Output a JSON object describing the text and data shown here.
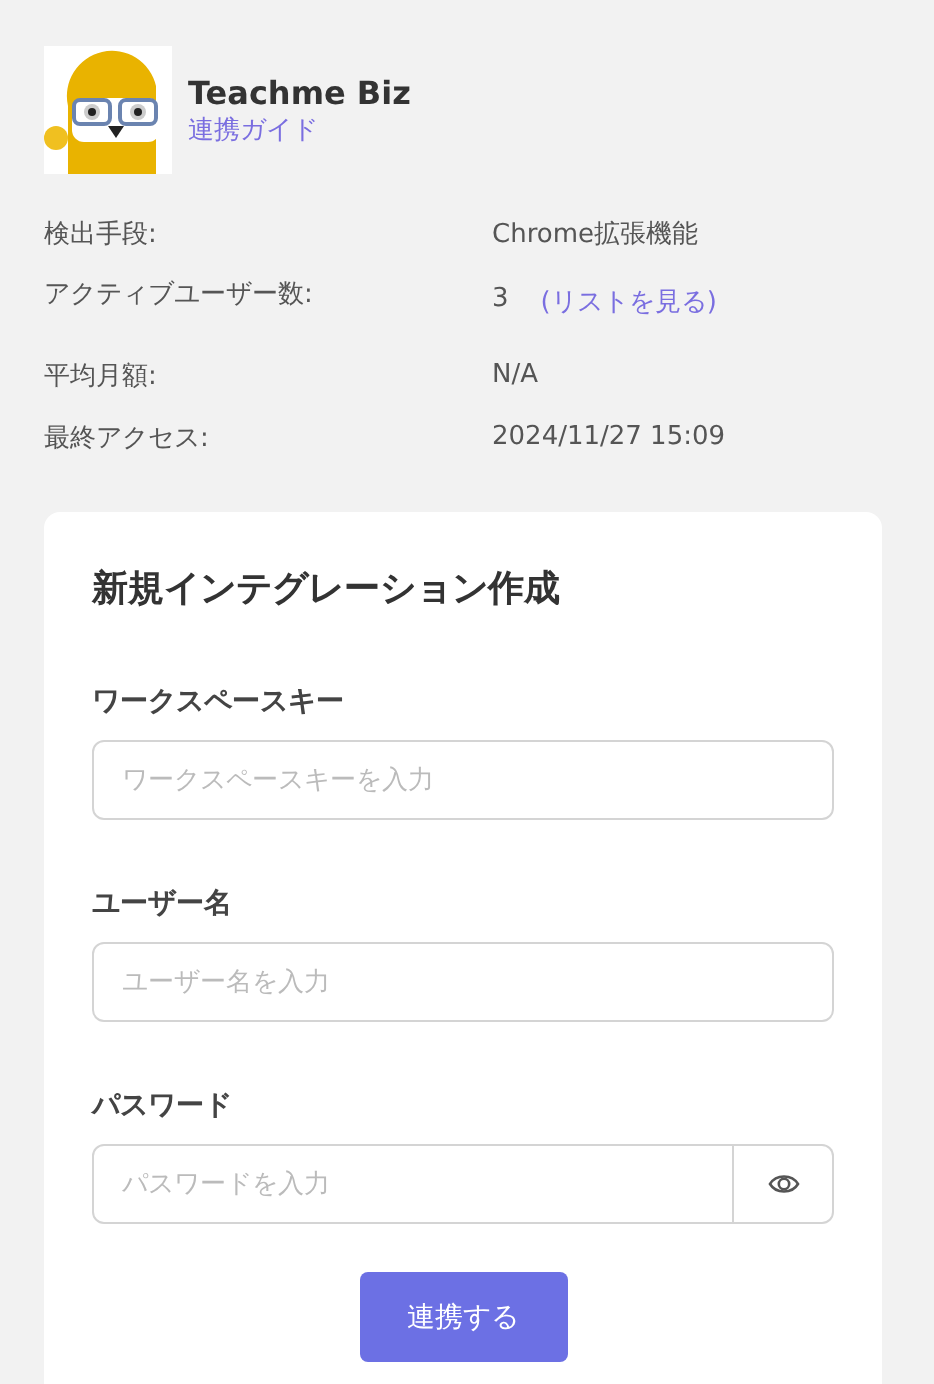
{
  "app": {
    "name": "Teachme Biz",
    "guide_link": "連携ガイド"
  },
  "details": [
    {
      "label": "検出手段:",
      "value": "Chrome拡張機能"
    },
    {
      "label": "アクティブユーザー数:",
      "value": "3",
      "link": "(リストを見る)"
    },
    {
      "label": "平均月額:",
      "value": "N/A"
    },
    {
      "label": "最終アクセス:",
      "value": "2024/11/27 15:09"
    }
  ],
  "form": {
    "title": "新規インテグレーション作成",
    "fields": [
      {
        "kind": "text",
        "label": "ワークスペースキー",
        "placeholder": "ワークスペースキーを入力"
      },
      {
        "kind": "text",
        "label": "ユーザー名",
        "placeholder": "ユーザー名を入力"
      },
      {
        "kind": "password",
        "label": "パスワード",
        "placeholder": "パスワードを入力"
      }
    ],
    "submit": "連携する"
  }
}
